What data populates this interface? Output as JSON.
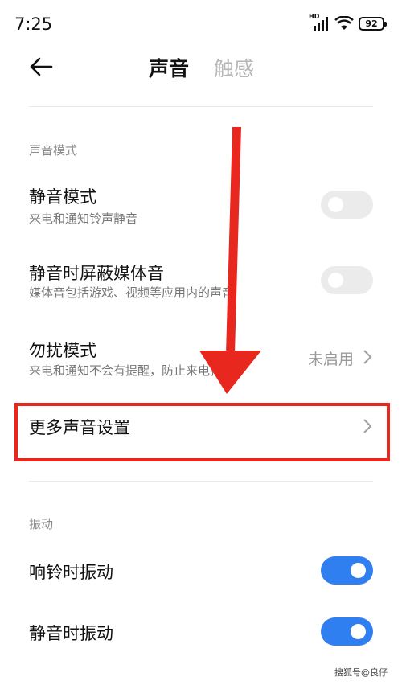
{
  "status_bar": {
    "time": "7:25",
    "network": "HD",
    "battery": "92"
  },
  "header": {
    "tab_active": "声音",
    "tab_inactive": "触感"
  },
  "sections": {
    "sound_mode_title": "声音模式",
    "vibration_title": "振动"
  },
  "rows": {
    "silent_mode": {
      "title": "静音模式",
      "subtitle": "来电和通知铃声静音",
      "toggle": "off"
    },
    "mute_media": {
      "title": "静音时屏蔽媒体音",
      "subtitle": "媒体音包括游戏、视频等应用内的声音",
      "toggle": "off"
    },
    "dnd": {
      "title": "勿扰模式",
      "subtitle": "来电和通知不会有提醒，防止来电打扰",
      "value": "未启用"
    },
    "more_sound": {
      "title": "更多声音设置"
    },
    "vibrate_ring": {
      "title": "响铃时振动",
      "toggle": "on"
    },
    "vibrate_silent": {
      "title": "静音时振动",
      "toggle": "on"
    }
  },
  "colors": {
    "accent": "#2f7ff0",
    "annotation_red": "#e8281f"
  },
  "watermark": "搜狐号@良仔"
}
